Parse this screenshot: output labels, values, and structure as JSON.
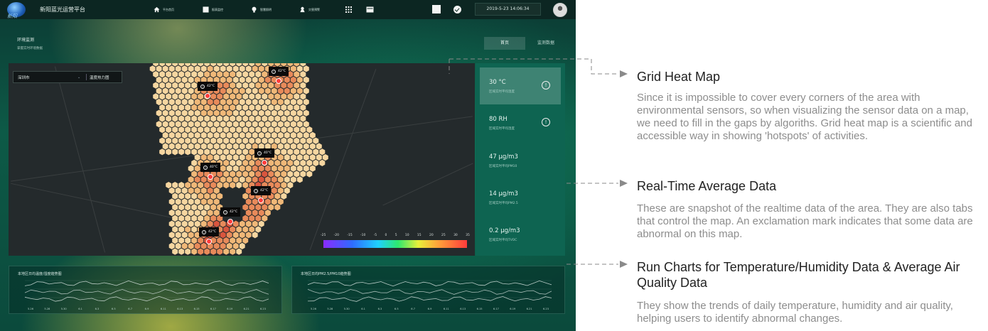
{
  "header": {
    "logo_text": "新阳",
    "app_title": "新阳蓝光运营平台",
    "nav": [
      {
        "label": "平台首页",
        "icon": "home-icon"
      },
      {
        "label": "报表监控",
        "icon": "report-icon"
      },
      {
        "label": "智慧照明",
        "icon": "bulb-icon"
      },
      {
        "label": "灾害预警",
        "icon": "alarm-icon"
      }
    ],
    "datetime": "2019-5-23 14:06:34"
  },
  "page": {
    "title": "环境监测",
    "subtitle": "掌握实时环境数据",
    "tabs": [
      "首页",
      "监测数据"
    ]
  },
  "map": {
    "city": "深圳市",
    "layer": "温度热力图",
    "markers": [
      {
        "label": "42°C"
      },
      {
        "label": "42°C"
      },
      {
        "label": "40°C"
      },
      {
        "label": "40°C"
      },
      {
        "label": "42°C"
      },
      {
        "label": "42°C"
      },
      {
        "label": "42°C"
      }
    ],
    "legend_ticks": [
      "-25",
      "-20",
      "-15",
      "-10",
      "-5",
      "0",
      "5",
      "10",
      "15",
      "20",
      "25",
      "30",
      "35"
    ]
  },
  "cards": [
    {
      "value": "30 °C",
      "label": "区域实时平均温度",
      "warning": true
    },
    {
      "value": "80 RH",
      "label": "区域实时平均湿度",
      "warning": true
    },
    {
      "value": "47 μg/m3",
      "label": "区域实时平均PM10",
      "warning": false
    },
    {
      "value": "14 μg/m3",
      "label": "区域实时平均PM2.5",
      "warning": false
    },
    {
      "value": "0.2 μg/m3",
      "label": "区域实时平均TVOC",
      "warning": false
    }
  ],
  "charts": [
    {
      "title": "本地区日均温度/湿度趋势图",
      "dates": [
        "5.26",
        "5.28",
        "5.30",
        "6.1",
        "6.3",
        "6.5",
        "6.7",
        "6.9",
        "6.11",
        "6.13",
        "6.15",
        "6.17",
        "6.19",
        "6.21",
        "6.23"
      ]
    },
    {
      "title": "本地区日均PM2.5/PM10趋势图",
      "dates": [
        "5.26",
        "5.28",
        "5.30",
        "6.1",
        "6.3",
        "6.5",
        "6.7",
        "6.9",
        "6.11",
        "6.13",
        "6.15",
        "6.17",
        "6.19",
        "6.21",
        "6.23"
      ]
    }
  ],
  "annotations": [
    {
      "heading": "Grid Heat Map",
      "body": "Since it is impossible to cover every corners of the area with environmental sensors, so when visualizing the sensor data on a map, we need to fill in the gaps by algoriths. Grid heat map is a scientific and accessible way in showing 'hotspots' of activities."
    },
    {
      "heading": "Real-Time Average Data",
      "body": "These are snapshot of the realtime data of the area. They are also tabs that control the map. An exclamation mark indicates that some data are abnormal on this map."
    },
    {
      "heading": "Run Charts for Temperature/Humidity Data & Average Air Quality Data",
      "body": "They show the trends of daily temperature, humidity and air quality, helping users to identify abnormal changes."
    }
  ],
  "colors": {
    "accent": "#0e6451",
    "hex_palette": [
      "#f6d6a0",
      "#f0b878",
      "#e88a5a",
      "#d9553e",
      "#ff3b3b"
    ],
    "marker": "#ff3b3b"
  }
}
